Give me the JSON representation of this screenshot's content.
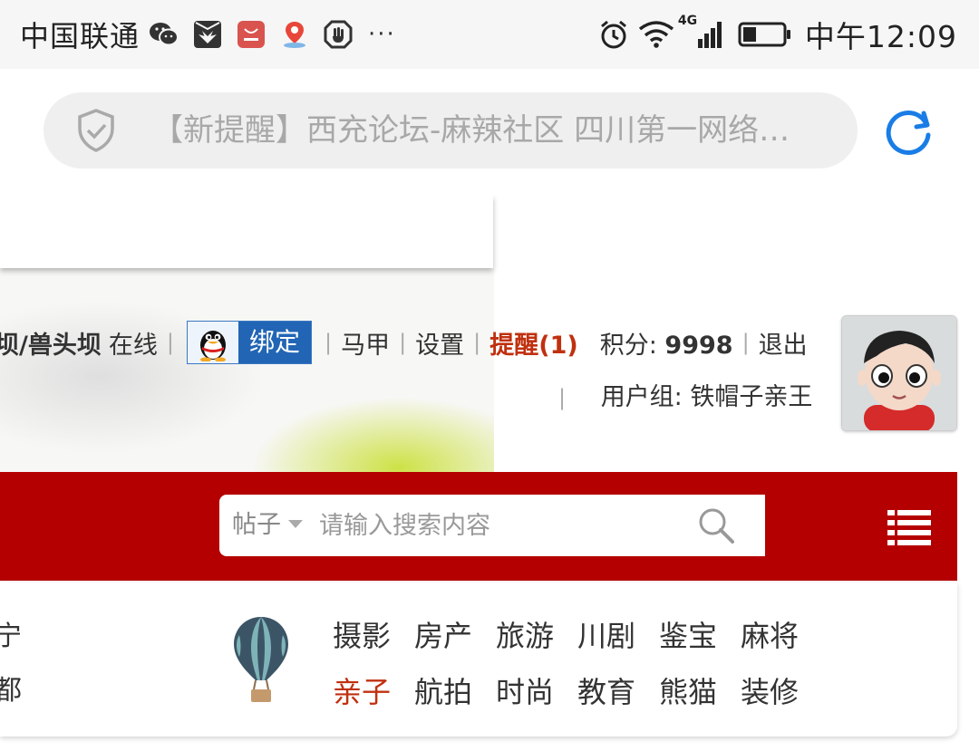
{
  "status_bar": {
    "carrier": "中国联通",
    "time": "中午12:09",
    "network": "4G",
    "notification_icons": [
      "wechat-icon",
      "huawei-icon",
      "app-gallery-icon",
      "baidu-map-icon",
      "hand-stop-icon"
    ],
    "more": "···"
  },
  "address_bar": {
    "title": "【新提醒】西充论坛-麻辣社区 四川第一网络…"
  },
  "user_bar": {
    "username": "坝/兽头坝",
    "online": "在线",
    "bind_label": "绑定",
    "sock": "马甲",
    "settings": "设置",
    "remind": "提醒(1)",
    "points_label": "积分: ",
    "points_value": "9998",
    "logout": "退出",
    "usergroup": "用户组: 铁帽子亲王",
    "separator": "|"
  },
  "search": {
    "type": "帖子",
    "placeholder": "请输入搜索内容"
  },
  "categories_left": [
    "宁",
    "都"
  ],
  "categories": [
    {
      "label": "摄影"
    },
    {
      "label": "房产"
    },
    {
      "label": "旅游"
    },
    {
      "label": "川剧"
    },
    {
      "label": "鉴宝"
    },
    {
      "label": "麻将"
    },
    {
      "label": "亲子",
      "hot": true
    },
    {
      "label": "航拍"
    },
    {
      "label": "时尚"
    },
    {
      "label": "教育"
    },
    {
      "label": "熊猫"
    },
    {
      "label": "装修"
    }
  ],
  "colors": {
    "brand_red": "#b40000",
    "remind": "#c0300f",
    "qq_blue": "#2265b5",
    "reload_blue": "#1a7de6"
  }
}
